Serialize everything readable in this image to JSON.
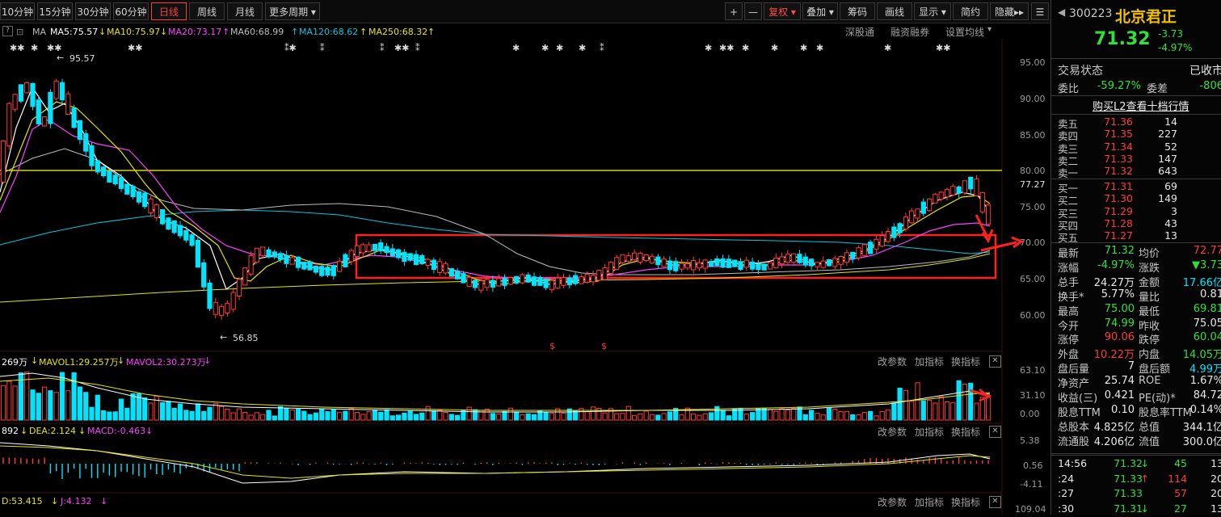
{
  "toolbar": {
    "periods": [
      "10分钟",
      "15分钟",
      "30分钟",
      "60分钟",
      "日线",
      "周线",
      "月线",
      "更多周期"
    ],
    "active_period": "日线",
    "plus": "+",
    "minus": "—",
    "fuquan": "复权",
    "diejia": "叠加",
    "chouma": "筹码",
    "huaxian": "画线",
    "xianshi": "显示",
    "jianyue": "简约",
    "yincang": "隐藏"
  },
  "ma_header": {
    "q": "?",
    "ma": "MA",
    "ma5": "MA5:75.57",
    "ma10": "MA10:75.97",
    "ma20": "MA20:73.17",
    "ma60": "MA60:68.99",
    "ma120": "MA120:68.62",
    "ma250": "MA250:68.32",
    "links": [
      "深股通",
      "融资融券",
      "设置均线"
    ]
  },
  "price_axis": [
    "95.00",
    "90.00",
    "85.00",
    "80.00",
    "77.27",
    "75.00",
    "70.00",
    "65.00",
    "60.00"
  ],
  "annotations": {
    "high": "95.57",
    "low": "56.85"
  },
  "vol_header": {
    "vol": "269万",
    "mavol1": "MAVOL1:29.257万",
    "mavol2": "MAVOL2:30.273万"
  },
  "vol_axis": [
    "63.10",
    "31.10",
    "0.00"
  ],
  "macd_header": {
    "dif": "892",
    "dea": "DEA:2.124",
    "macd": "MACD:-0.463"
  },
  "macd_axis": [
    "5.38",
    "0.56",
    "-4.11"
  ],
  "kdj_header": {
    "d": "D:53.415",
    "j": "J:4.132"
  },
  "kdj_axis": [
    "109.04"
  ],
  "panel_links": [
    "改参数",
    "加指标",
    "换指标"
  ],
  "stock": {
    "code": "300223",
    "name": "北京君正",
    "price": "71.32",
    "change": "-3.73",
    "pct": "-4.97%"
  },
  "status": {
    "label": "交易状态",
    "value": "已收市"
  },
  "weibi": {
    "label": "委比",
    "value": "-59.27%",
    "label2": "委差",
    "value2": "-806"
  },
  "l2_link": "购买L2查看十档行情",
  "asks": [
    {
      "label": "卖五",
      "price": "71.36",
      "vol": "14"
    },
    {
      "label": "卖四",
      "price": "71.35",
      "vol": "227"
    },
    {
      "label": "卖三",
      "price": "71.34",
      "vol": "52"
    },
    {
      "label": "卖二",
      "price": "71.33",
      "vol": "147"
    },
    {
      "label": "卖一",
      "price": "71.32",
      "vol": "643"
    }
  ],
  "bids": [
    {
      "label": "买一",
      "price": "71.31",
      "vol": "69"
    },
    {
      "label": "买二",
      "price": "71.30",
      "vol": "149"
    },
    {
      "label": "买三",
      "price": "71.29",
      "vol": "3"
    },
    {
      "label": "买四",
      "price": "71.28",
      "vol": "43"
    },
    {
      "label": "买五",
      "price": "71.27",
      "vol": "13"
    }
  ],
  "stats": [
    {
      "l1": "最新",
      "v1": "71.32",
      "c1": "green",
      "l2": "均价",
      "v2": "72.77",
      "c2": "redc"
    },
    {
      "l1": "涨幅",
      "v1": "-4.97%",
      "c1": "green",
      "l2": "涨跌",
      "v2": "▼3.73",
      "c2": "green"
    },
    {
      "l1": "总手",
      "v1": "24.27万",
      "c1": "white",
      "l2": "金额",
      "v2": "17.66亿",
      "c2": "cyan"
    },
    {
      "l1": "换手*",
      "v1": "5.77%",
      "c1": "white",
      "l2": "量比",
      "v2": "0.81",
      "c2": "white"
    },
    {
      "l1": "最高",
      "v1": "75.00",
      "c1": "green",
      "l2": "最低",
      "v2": "69.81",
      "c2": "green"
    },
    {
      "l1": "今开",
      "v1": "74.99",
      "c1": "green",
      "l2": "昨收",
      "v2": "75.05",
      "c2": "white"
    },
    {
      "l1": "涨停",
      "v1": "90.06",
      "c1": "redc",
      "l2": "跌停",
      "v2": "60.04",
      "c2": "green"
    },
    {
      "l1": "外盘",
      "v1": "10.22万",
      "c1": "redc",
      "l2": "内盘",
      "v2": "14.05万",
      "c2": "green"
    },
    {
      "l1": "盘后量",
      "v1": "7",
      "c1": "white",
      "l2": "盘后额",
      "v2": "4.99万",
      "c2": "cyan"
    },
    {
      "l1": "净资产",
      "v1": "25.74",
      "c1": "white",
      "l2": "ROE",
      "v2": "1.67%",
      "c2": "white"
    },
    {
      "l1": "收益(三)",
      "v1": "0.421",
      "c1": "white",
      "l2": "PE(动)*",
      "v2": "84.72",
      "c2": "white"
    },
    {
      "l1": "股息TTM",
      "v1": "0.10",
      "c1": "white",
      "l2": "股息率TTM",
      "v2": "0.14%",
      "c2": "white"
    },
    {
      "l1": "总股本",
      "v1": "4.825亿",
      "c1": "white",
      "l2": "总值",
      "v2": "344.1亿",
      "c2": "white"
    },
    {
      "l1": "流通股",
      "v1": "4.206亿",
      "c1": "white",
      "l2": "流值",
      "v2": "300.0亿",
      "c2": "white"
    }
  ],
  "ticks": [
    {
      "t": "14:56",
      "p": "71.32",
      "arrow": "↓",
      "ac": "green",
      "v": "45",
      "vc": "green",
      "n": "13"
    },
    {
      "t": ":24",
      "p": "71.33",
      "arrow": "↑",
      "ac": "redc",
      "v": "114",
      "vc": "redc",
      "n": "20"
    },
    {
      "t": ":27",
      "p": "71.33",
      "arrow": "",
      "ac": "",
      "v": "57",
      "vc": "redc",
      "n": "20"
    },
    {
      "t": ":30",
      "p": "71.31",
      "arrow": "↓",
      "ac": "green",
      "v": "27",
      "vc": "green",
      "n": "13"
    }
  ],
  "colors": {
    "up": "#ff3b3b",
    "down": "#00e5ff",
    "ma5": "#ffffff",
    "ma10": "#e6e600",
    "ma20": "#ff40ff",
    "ma60": "#bdbdbd",
    "ma120": "#00c8e0",
    "ma250": "#e6e600",
    "hline": "#ffff00",
    "box": "#ff2020"
  }
}
